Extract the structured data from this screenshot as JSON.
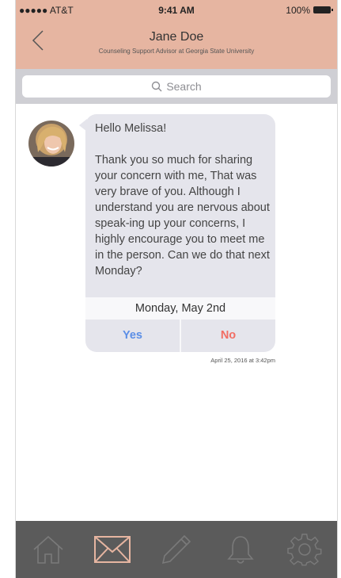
{
  "status_bar": {
    "carrier": "●●●●● AT&T",
    "time": "9:41 AM",
    "battery": "100%"
  },
  "header": {
    "title": "Jane Doe",
    "subtitle": "Counseling Support Advisor at Georgia State University"
  },
  "search": {
    "placeholder": "Search"
  },
  "message": {
    "text": "Hello Melissa!\n\nThank you so much for sharing your concern with me, That was very brave of you. Although I understand you are nervous about speak-ing up your concerns, I highly encourage you to meet me in the person. Can we do that next Monday?",
    "proposed_date": "Monday, May 2nd",
    "yes_label": "Yes",
    "no_label": "No",
    "timestamp": "April 25, 2016 at 3:42pm"
  },
  "tabbar": {
    "items": [
      "home-icon",
      "mail-icon",
      "pencil-icon",
      "bell-icon",
      "gear-icon"
    ],
    "active": "mail-icon"
  },
  "colors": {
    "header_bg": "#e6b5a1",
    "yes": "#5b8ee6",
    "no": "#f26d63",
    "tabbar_bg": "#5b5b5b",
    "active_icon": "#e6b5a1",
    "inactive_icon": "#7a7a7a"
  }
}
